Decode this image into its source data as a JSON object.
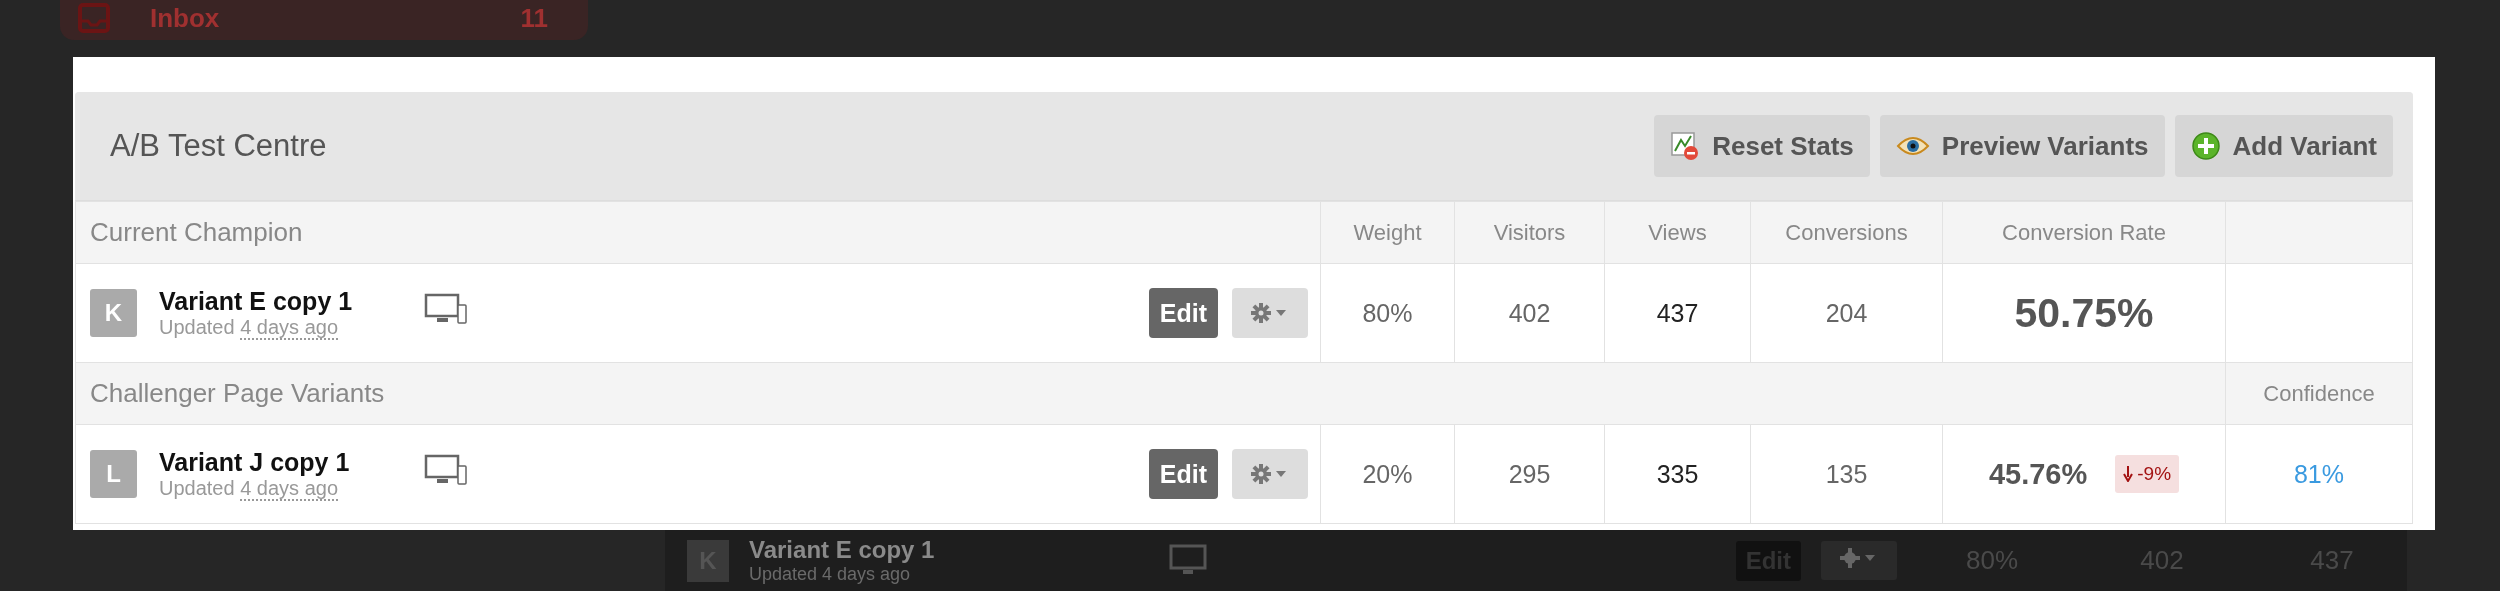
{
  "background": {
    "sidebar_item": {
      "label": "Inbox",
      "count": "11"
    },
    "row": {
      "badge": "K",
      "name": "Variant E copy 1",
      "updated": "Updated 4 days ago",
      "edit": "Edit",
      "weight": "80%",
      "visitors": "402",
      "views": "437"
    }
  },
  "modal": {
    "title": "A/B Test Centre",
    "buttons": [
      {
        "label": "Reset Stats",
        "kind": "reset"
      },
      {
        "label": "Preview Variants",
        "kind": "preview"
      },
      {
        "label": "Add Variant",
        "kind": "add"
      }
    ],
    "columns": [
      "Weight",
      "Visitors",
      "Views",
      "Conversions",
      "Conversion Rate"
    ],
    "sections": [
      {
        "label": "Current Champion",
        "kind": "champion",
        "rows": [
          {
            "badge": "K",
            "name": "Variant E copy 1",
            "updated": "Updated",
            "updated_when": "4 days ago",
            "edit": "Edit",
            "weight": "80%",
            "visitors": "402",
            "views": "437",
            "conversions": "204",
            "rate": "50.75%"
          }
        ]
      },
      {
        "label": "Challenger Page Variants",
        "kind": "challenger",
        "side_label": "Confidence",
        "rows": [
          {
            "badge": "L",
            "name": "Variant J copy 1",
            "updated": "Updated",
            "updated_when": "4 days ago",
            "edit": "Edit",
            "weight": "20%",
            "visitors": "295",
            "views": "335",
            "conversions": "135",
            "rate": "45.76%",
            "change": {
              "text": "-9%",
              "down": true
            },
            "confidence": "81%"
          }
        ]
      }
    ]
  }
}
